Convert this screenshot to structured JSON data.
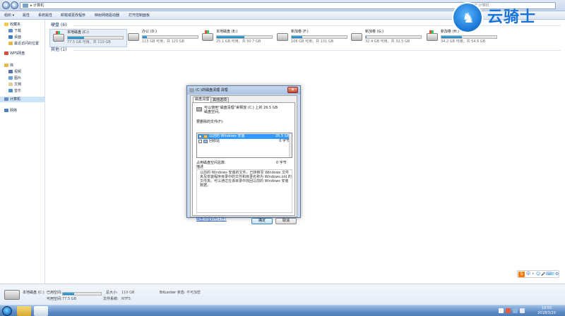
{
  "window": {
    "address": "计算机",
    "address_sep": "▸",
    "search_placeholder": "搜索 计算机"
  },
  "toolbar": [
    "组织 ▾",
    "属性",
    "系统属性",
    "卸载或更改程序",
    "映射网络驱动器",
    "打开控制面板"
  ],
  "sidebar": {
    "favorites": "收藏夹",
    "fav_items": [
      "下载",
      "桌面",
      "最近访问的位置"
    ],
    "wps": "WPS网盘",
    "library": "库",
    "lib_items": [
      "视频",
      "图片",
      "文档",
      "音乐"
    ],
    "computer": "计算机",
    "network": "网络"
  },
  "content": {
    "hdd_group": "硬盘 (6)",
    "other_group": "其他 (1)",
    "drives": [
      {
        "name": "本地磁盘 (C:)",
        "free": "77.5 GB 可用，共 110 GB",
        "used": 0.3,
        "icon": "windows-drive-icon"
      },
      {
        "name": "办公 (D:)",
        "free": "115 GB 可用，共 125 GB",
        "used": 0.08,
        "icon": "drive-icon"
      },
      {
        "name": "本地磁盘 (E:)",
        "free": "25.1 GB 可用，共 50.7 GB",
        "used": 0.5,
        "icon": "drive-icon"
      },
      {
        "name": "新加卷 (F:)",
        "free": "106 GB 可用，共 131 GB",
        "used": 0.19,
        "icon": "drive-icon"
      },
      {
        "name": "新加卷 (G:)",
        "free": "32.4 GB 可用，共 32.5 GB",
        "used": 0.01,
        "icon": "drive-icon"
      },
      {
        "name": "新加卷 (H:)",
        "free": "34.2 GB 可用，共 54.6 GB",
        "used": 0.37,
        "icon": "drive-icon"
      }
    ]
  },
  "details": {
    "name": "本地磁盘 (C:)",
    "used_label": "已用空间:",
    "free_label": "可用空间:",
    "free_value": "77.5 GB",
    "total_label": "总大小:",
    "total_value": "110 GB",
    "fs_label": "文件系统:",
    "fs_value": "NTFS",
    "bitlocker_label": "BitLocker 状态:",
    "bitlocker_value": "不可加密",
    "used_fraction": 0.3
  },
  "dialog": {
    "title": "(C:)的磁盘清理 清理",
    "tab1": "磁盘清理",
    "tab2": "其他选项",
    "intro_line1": "可以使用“磁盘清理”来释放 (C:) 上的 26.5 GB",
    "intro_line2": "磁盘空间。",
    "files_label": "要删除的文件(F):",
    "files": [
      {
        "name": "以前的 Windows 安装",
        "size": "26.5 GB",
        "checked": true
      },
      {
        "name": "回收站",
        "size": "0 字节",
        "checked": false
      }
    ],
    "gain_label": "占用磁盘空间总数:",
    "gain_value": "0 字节",
    "desc_label": "描述",
    "description": "以前的 Windows 安装的文件。已转移至 Windows 文件夹及安装程序目录中的文件和目录名称为 Windows.old 的文件夹。可以通过在该目录中找回以前的 Windows 安装数据。",
    "link": "磁盘清理如何工作?",
    "ok": "确定",
    "cancel": "取消"
  },
  "logo": {
    "text": "云骑士"
  },
  "ime": {
    "s": "S",
    "glyphs": [
      "中",
      "•",
      "☺",
      "🎤",
      "⌨",
      "👕",
      "⚙"
    ]
  },
  "clock": {
    "time": "10:55",
    "date": "2018/3/20"
  },
  "colors": {
    "accent": "#1b7fbd",
    "selection": "#3399ff",
    "logo": "#1a73d8"
  }
}
